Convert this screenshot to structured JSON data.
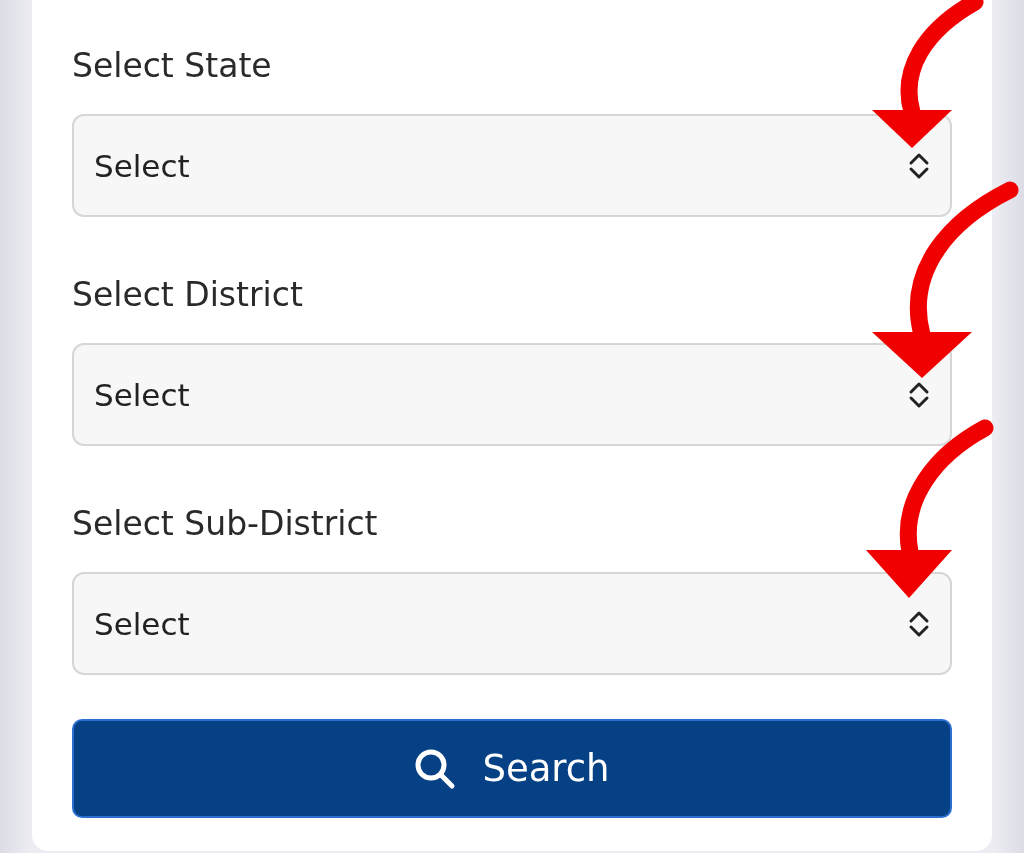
{
  "fields": [
    {
      "label": "Select State",
      "value": "Select"
    },
    {
      "label": "Select District",
      "value": "Select"
    },
    {
      "label": "Select Sub-District",
      "value": "Select"
    }
  ],
  "search_button": {
    "label": "Search"
  }
}
